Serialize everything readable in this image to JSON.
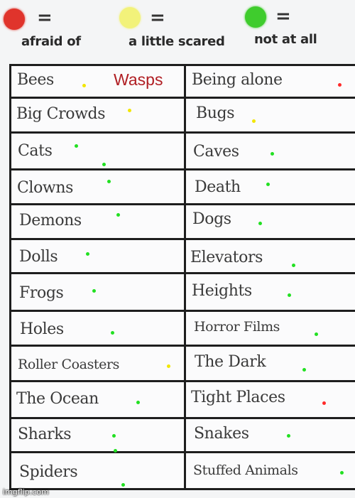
{
  "legend": [
    {
      "label": "afraid of",
      "color": "#e0342c",
      "symbol": "="
    },
    {
      "label": "a little scared",
      "color": "#f2f27a",
      "symbol": "="
    },
    {
      "label": "not at all",
      "color": "#3fcc2d",
      "symbol": "="
    }
  ],
  "dot_colors": {
    "red": "#ff2a2a",
    "yellow": "#f2e600",
    "green": "#22e022"
  },
  "annotation": {
    "text": "Wasps",
    "color": "#b01e23"
  },
  "rows": [
    {
      "left": {
        "label": "Bees",
        "marks": [
          "yellow"
        ]
      },
      "right": {
        "label": "Being alone",
        "marks": [
          "red"
        ]
      }
    },
    {
      "left": {
        "label": "Big Crowds",
        "marks": [
          "yellow"
        ]
      },
      "right": {
        "label": "Bugs",
        "marks": [
          "yellow"
        ]
      }
    },
    {
      "left": {
        "label": "Cats",
        "marks": [
          "green",
          "green"
        ]
      },
      "right": {
        "label": "Caves",
        "marks": [
          "green"
        ]
      }
    },
    {
      "left": {
        "label": "Clowns",
        "marks": [
          "green"
        ]
      },
      "right": {
        "label": "Death",
        "marks": [
          "green"
        ]
      }
    },
    {
      "left": {
        "label": "Demons",
        "marks": [
          "green"
        ]
      },
      "right": {
        "label": "Dogs",
        "marks": [
          "green"
        ]
      }
    },
    {
      "left": {
        "label": "Dolls",
        "marks": [
          "green"
        ]
      },
      "right": {
        "label": "Elevators",
        "marks": [
          "green"
        ]
      }
    },
    {
      "left": {
        "label": "Frogs",
        "marks": [
          "green"
        ]
      },
      "right": {
        "label": "Heights",
        "marks": [
          "green"
        ]
      }
    },
    {
      "left": {
        "label": "Holes",
        "marks": [
          "green"
        ]
      },
      "right": {
        "label": "Horror Films",
        "marks": [
          "green"
        ]
      }
    },
    {
      "left": {
        "label": "Roller Coasters",
        "marks": [
          "yellow"
        ]
      },
      "right": {
        "label": "The Dark",
        "marks": [
          "green"
        ]
      }
    },
    {
      "left": {
        "label": "The Ocean",
        "marks": [
          "green"
        ]
      },
      "right": {
        "label": "Tight Places",
        "marks": [
          "red"
        ]
      }
    },
    {
      "left": {
        "label": "Sharks",
        "marks": [
          "green",
          "green"
        ]
      },
      "right": {
        "label": "Snakes",
        "marks": [
          "green"
        ]
      }
    },
    {
      "left": {
        "label": "Spiders",
        "marks": [
          "green"
        ]
      },
      "right": {
        "label": "Stuffed Animals",
        "marks": [
          "green"
        ]
      }
    }
  ],
  "watermark": "imgflip.com"
}
